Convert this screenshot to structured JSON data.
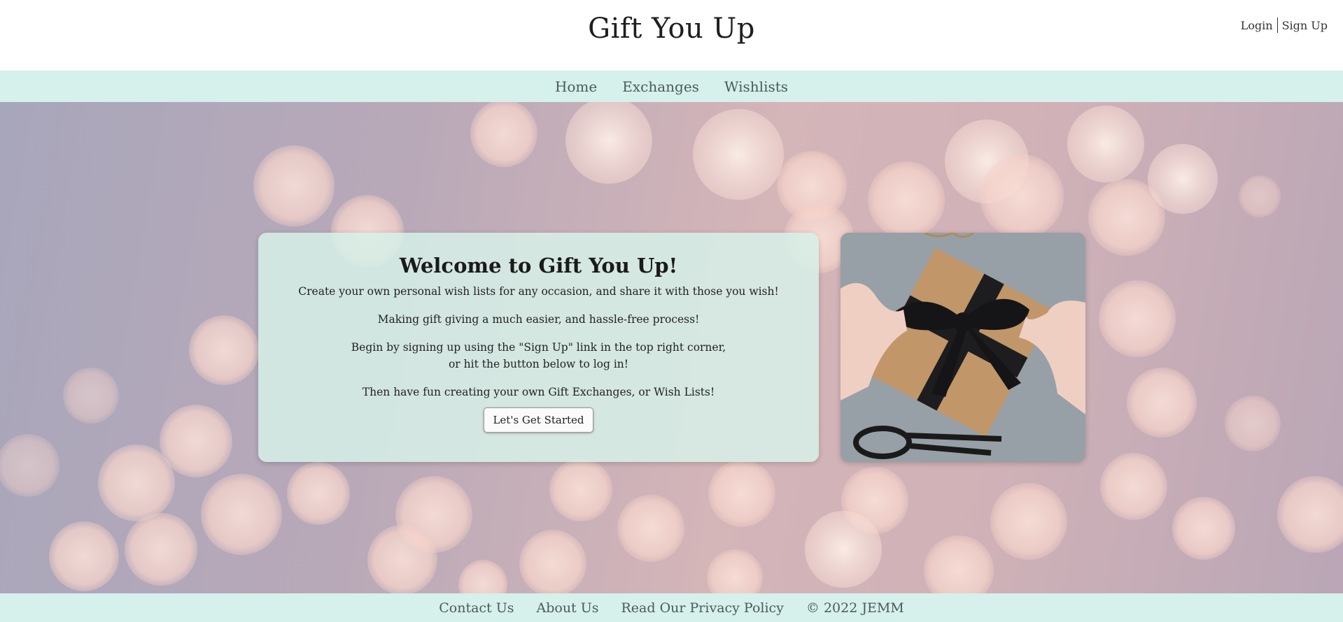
{
  "header": {
    "title": "Gift You Up",
    "login_label": "Login",
    "signup_label": "Sign Up"
  },
  "nav": {
    "items": [
      {
        "label": "Home"
      },
      {
        "label": "Exchanges"
      },
      {
        "label": "Wishlists"
      }
    ]
  },
  "welcome": {
    "title": "Welcome to Gift You Up!",
    "line1": "Create your own personal wish lists for any occasion, and share it with those you wish!",
    "line2": "Making gift giving a much easier, and hassle-free process!",
    "line3a": "Begin by signing up using the \"Sign Up\" link in the top right corner,",
    "line3b": "or hit the button below to log in!",
    "line4": "Then have fun creating your own Gift Exchanges, or Wish Lists!",
    "button_label": "Let's Get Started"
  },
  "footer": {
    "contact_label": "Contact Us",
    "about_label": "About Us",
    "privacy_label": "Read Our Privacy Policy",
    "copyright": "© 2022 JEMM"
  },
  "colors": {
    "nav_bg": "#d6f0eb",
    "card_bg": "#d6f0e8",
    "bokeh": "#f6d8d0"
  }
}
